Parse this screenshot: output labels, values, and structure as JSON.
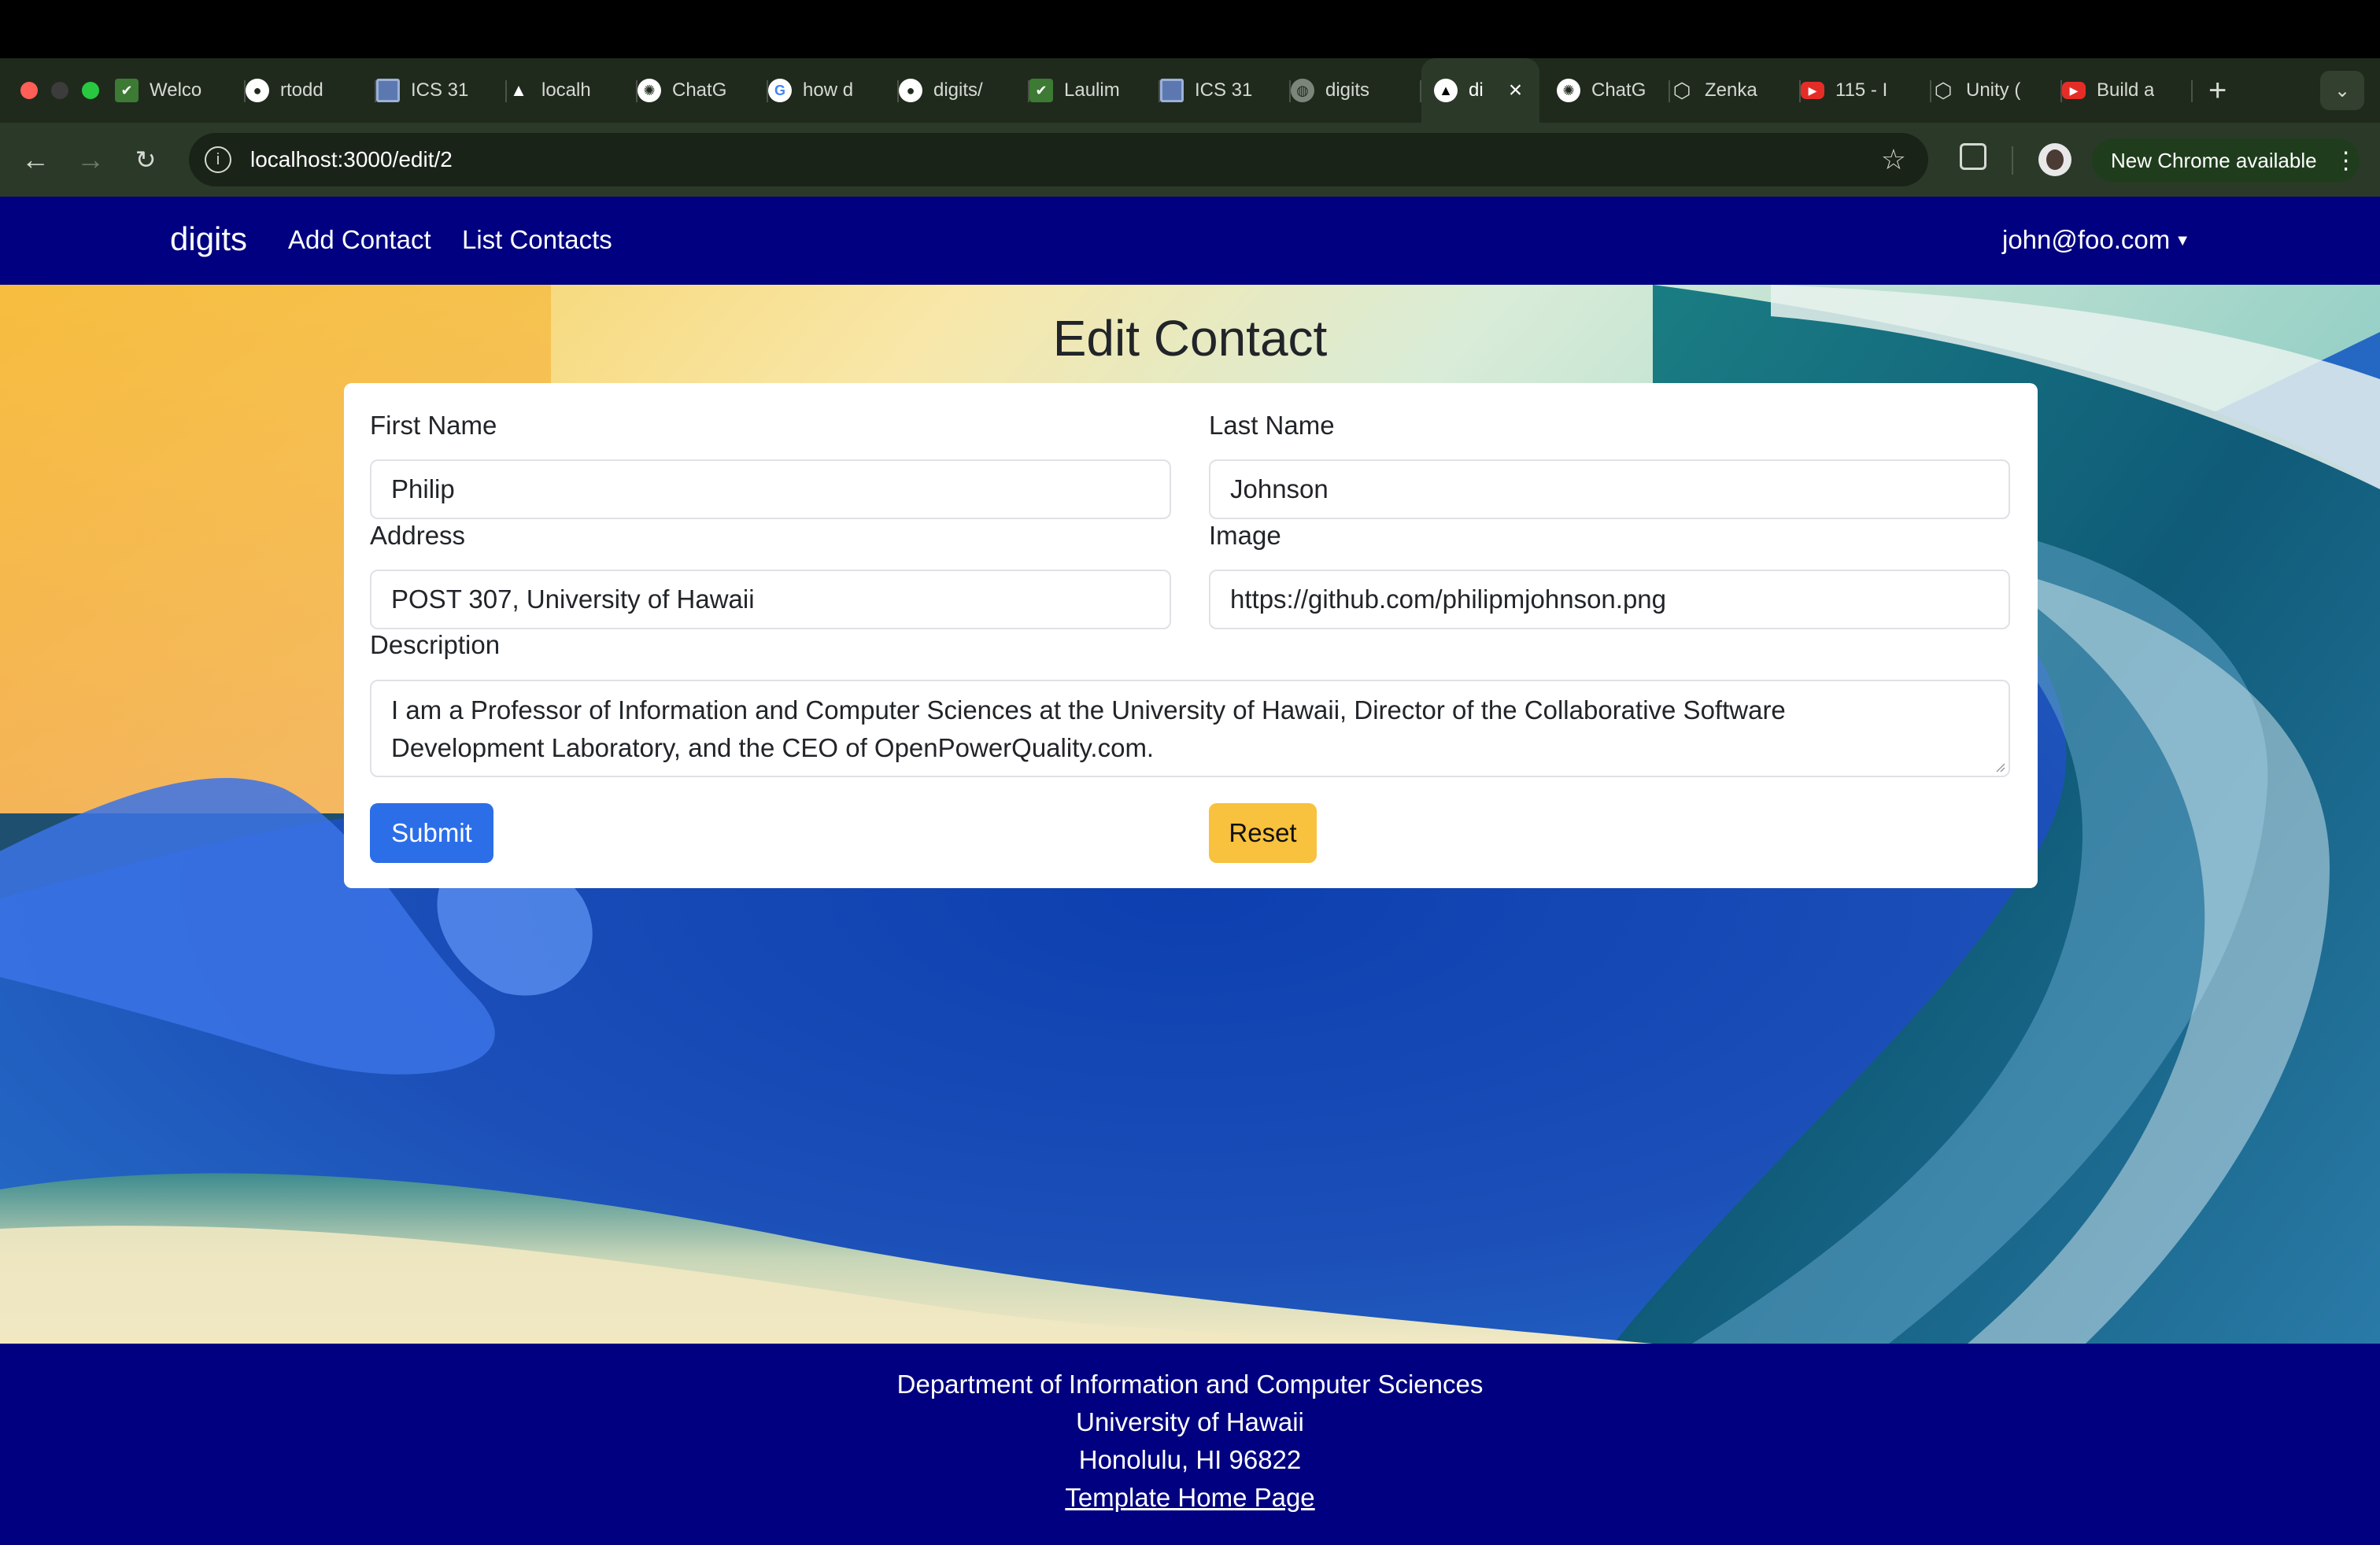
{
  "browser": {
    "tabs": [
      {
        "label": "Welco",
        "icon": "leaf-icon"
      },
      {
        "label": "rtodd",
        "icon": "github-icon"
      },
      {
        "label": "ICS 31",
        "icon": "square-icon"
      },
      {
        "label": "localh",
        "icon": "triangle-icon"
      },
      {
        "label": "ChatG",
        "icon": "openai-icon"
      },
      {
        "label": "how d",
        "icon": "google-icon"
      },
      {
        "label": "digits/",
        "icon": "github-icon"
      },
      {
        "label": "Laulim",
        "icon": "leaf-icon"
      },
      {
        "label": "ICS 31",
        "icon": "square-icon"
      },
      {
        "label": "digits",
        "icon": "globe-icon"
      }
    ],
    "active_tab": {
      "label": "di",
      "icon": "triangle-icon"
    },
    "tabs_after": [
      {
        "label": "ChatG",
        "icon": "openai-icon"
      },
      {
        "label": "Zenka",
        "icon": "unity-icon"
      },
      {
        "label": "115 - I",
        "icon": "youtube-icon"
      },
      {
        "label": "Unity (",
        "icon": "unity-icon"
      },
      {
        "label": "Build a",
        "icon": "youtube-icon"
      }
    ],
    "url": "localhost:3000/edit/2",
    "update_pill": "New Chrome available"
  },
  "navbar": {
    "brand": "digits",
    "links": [
      "Add Contact",
      "List Contacts"
    ],
    "user": "john@foo.com"
  },
  "form": {
    "title": "Edit Contact",
    "first_name_label": "First Name",
    "first_name_value": "Philip",
    "last_name_label": "Last Name",
    "last_name_value": "Johnson",
    "address_label": "Address",
    "address_value": "POST 307, University of Hawaii",
    "image_label": "Image",
    "image_value": "https://github.com/philipmjohnson.png",
    "description_label": "Description",
    "description_line1": "I am a Professor of Information and Computer Sciences at the University of Hawaii, Director of the Collaborative Software",
    "description_line2": "Development Laboratory, and the CEO of OpenPowerQuality.com.",
    "submit_label": "Submit",
    "reset_label": "Reset"
  },
  "footer": {
    "line1": "Department of Information and Computer Sciences",
    "line2": "University of Hawaii",
    "line3": "Honolulu, HI 96822",
    "link": "Template Home Page"
  },
  "colors": {
    "navbar_bg": "#000080",
    "submit_bg": "#2c6ee8",
    "reset_bg": "#f8c13e"
  }
}
